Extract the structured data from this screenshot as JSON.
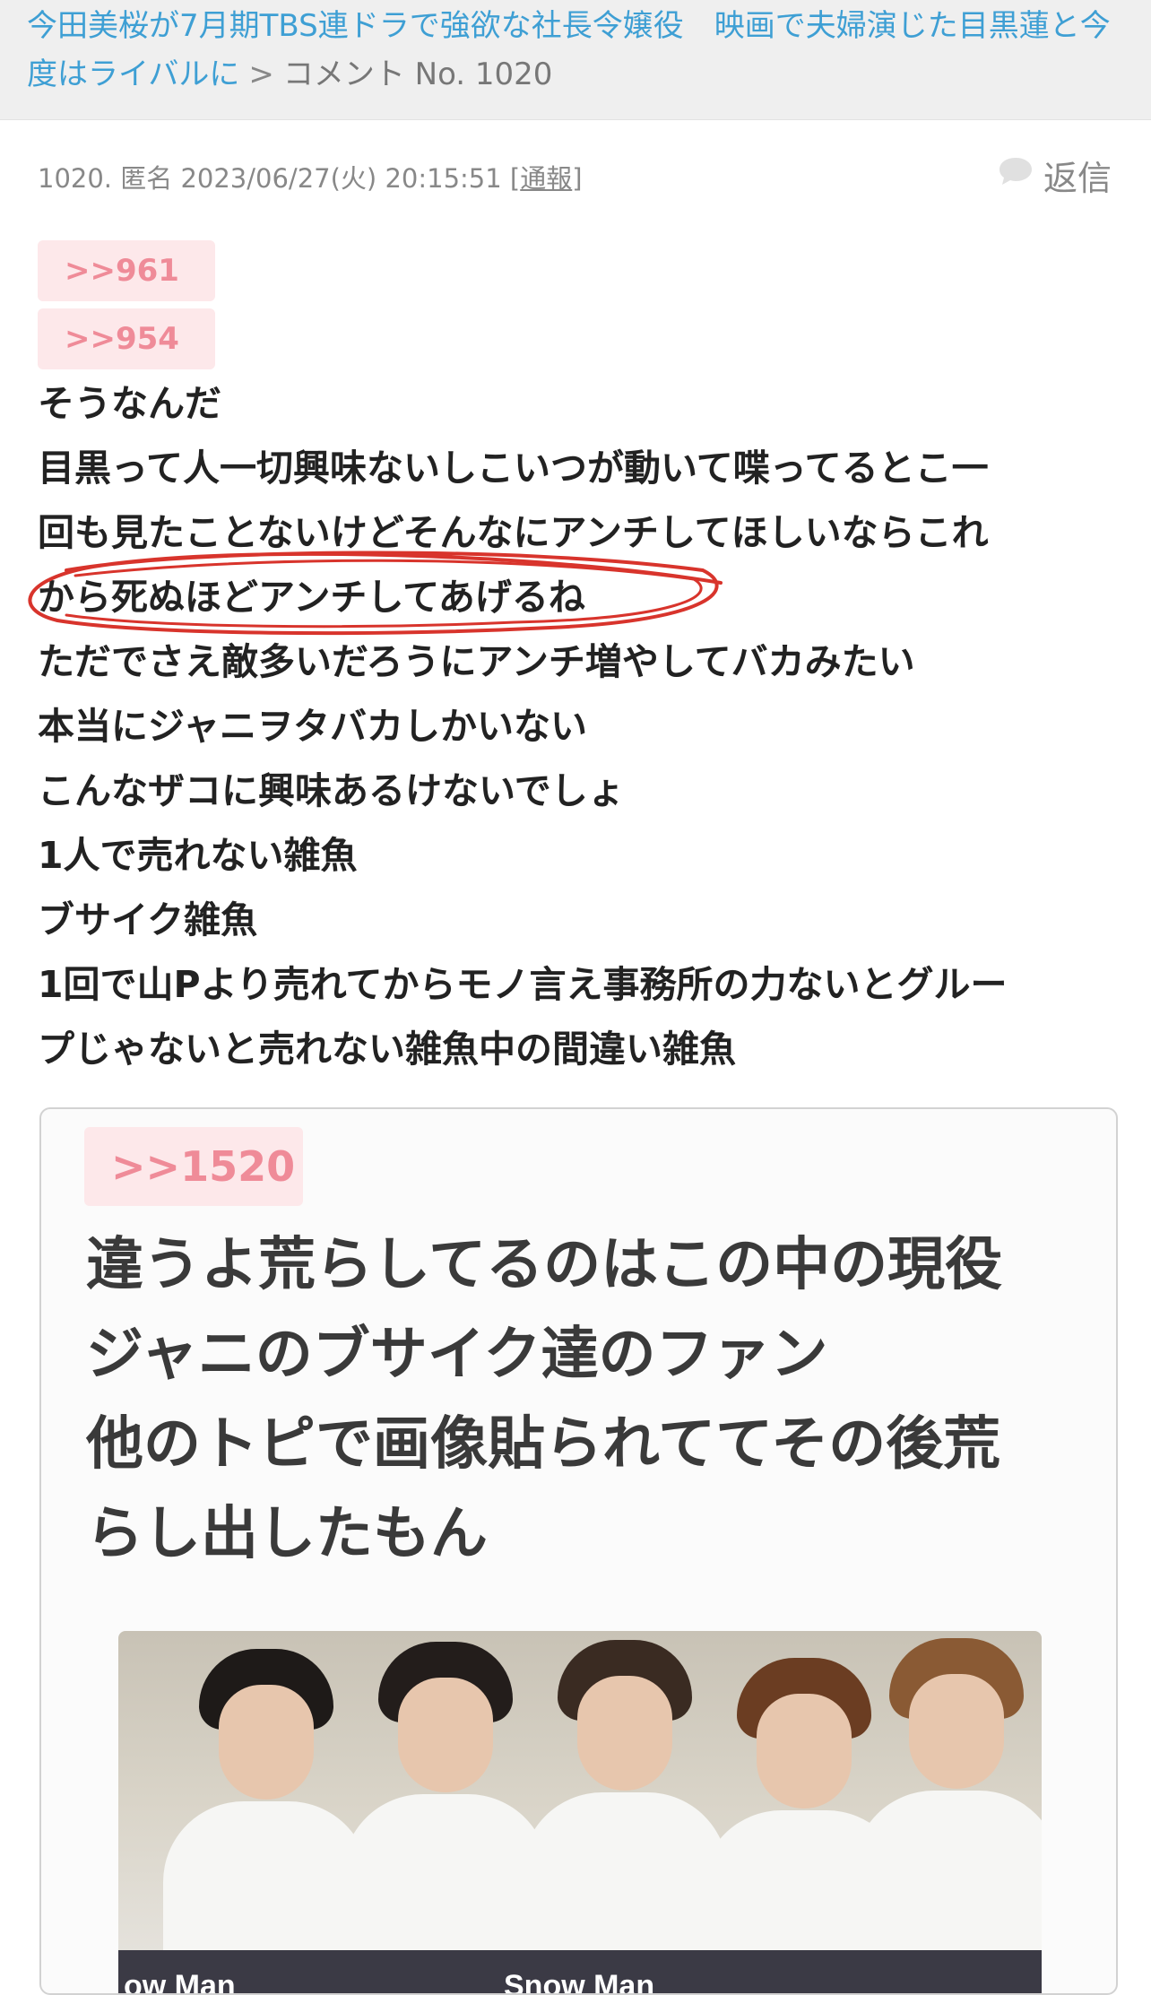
{
  "header": {
    "topic_title": "今田美桜が7月期TBS連ドラで強欲な社長令嬢役　映画で夫婦演じた目黒蓮と今度はライバルに",
    "separator": ">",
    "comment_label": "コメント No. 1020"
  },
  "comment": {
    "meta": "1020. 匿名 2023/06/27(火) 20:15:51 [",
    "report_label": "通報",
    "meta_close": "]",
    "reply_label": "返信",
    "anchors": [
      ">>961",
      ">>954"
    ],
    "lines": [
      "そうなんだ",
      "目黒って人一切興味ないしこいつが動いて喋ってるとこ一",
      "回も見たことないけどそんなにアンチしてほしいならこれ",
      "から死ぬほどアンチしてあげるね",
      "ただでさえ敵多いだろうにアンチ増やしてバカみたい",
      "本当にジャニヲタバカしかいない",
      "こんなザコに興味あるけないでしょ",
      "1人で売れない雑魚",
      "ブサイク雑魚",
      "1回で山Pより売れてからモノ言え事務所の力ないとグルー",
      "プじゃないと売れない雑魚中の間違い雑魚"
    ]
  },
  "quoted_image": {
    "anchor": ">>1520",
    "lines": [
      "違うよ荒らしてるのはこの中の現役",
      "ジャニのブサイク達のファン",
      "他のトピで画像貼られててその後荒",
      "らし出したもん"
    ],
    "banner_fragments": [
      "ow Man",
      "Snow Man"
    ]
  },
  "colors": {
    "link": "#3e9fd4",
    "anchor_bg": "#fde8ea",
    "anchor_text": "#ef8b98",
    "highlight_circle": "#d8342c"
  }
}
